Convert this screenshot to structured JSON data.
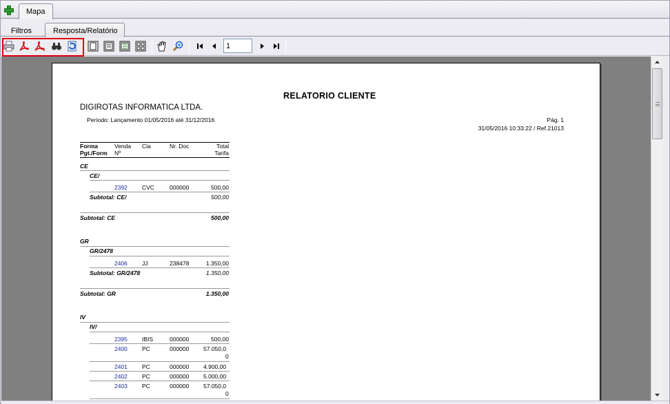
{
  "tabs": {
    "top": [
      {
        "label": "Mapa"
      }
    ],
    "sub": [
      {
        "label": "Filtros"
      },
      {
        "label": "Resposta/Relatório"
      }
    ]
  },
  "toolbar": {
    "icons": [
      "print-icon",
      "pdf-icon",
      "pdf-export-icon",
      "find-icon",
      "refresh-icon",
      "single-page-icon",
      "page-width-icon",
      "multi-page-icon",
      "thumbnails-icon",
      "hand-icon",
      "zoom-icon",
      "first-page-icon",
      "prev-page-icon",
      "next-page-icon",
      "last-page-icon"
    ],
    "page_value": "1"
  },
  "report": {
    "title": "RELATORIO CLIENTE",
    "company": "DIGIROTAS INFORMATICA LTDA.",
    "periodo": "Período: Lançamento 01/05/2016 até 31/12/2016",
    "pagina": "Pág. 1",
    "datetime": "31/05/2016 10:33:22 / Ref.21013",
    "headers": {
      "forma": "Forma",
      "forma2": "Pgt./Form",
      "venda": "Venda",
      "venda2": "Nº",
      "cia": "Cia",
      "nrdoc": "Nr. Doc",
      "total": "Total",
      "total2": "Tarifa"
    },
    "groups": {
      "ce": "CE",
      "ce_sub": "CE/",
      "ce_row": {
        "venda": "2392",
        "cia": "CVC",
        "doc": "000000",
        "val": "500,00"
      },
      "ce_subtotal_label": "Subtotal: CE/",
      "ce_subtotal_val": "500,00",
      "ce_total_label": "Subtotal: CE",
      "ce_total_val": "500,00",
      "gr": "GR",
      "gr_sub": "GR/2478",
      "gr_row": {
        "venda": "2406",
        "cia": "JJ",
        "doc": "238478",
        "val": "1.350,00"
      },
      "gr_subtotal_label": "Subtotal: GR/2478",
      "gr_subtotal_val": "1.350,00",
      "gr_total_label": "Subtotal: GR",
      "gr_total_val": "1.350,00",
      "iv": "IV",
      "iv_sub": "IV/",
      "iv_rows": [
        {
          "venda": "2395",
          "cia": "IBIS",
          "doc": "000000",
          "val": "500,00",
          "val2": ""
        },
        {
          "venda": "2400",
          "cia": "PC",
          "doc": "000000",
          "val": "57.050,0",
          "val2": "0"
        },
        {
          "venda": "2401",
          "cia": "PC",
          "doc": "000000",
          "val": "4.900,00",
          "val2": ""
        },
        {
          "venda": "2402",
          "cia": "PC",
          "doc": "000000",
          "val": "5.000,00",
          "val2": ""
        },
        {
          "venda": "2403",
          "cia": "PC",
          "doc": "000000",
          "val": "57.050,0",
          "val2": "0"
        }
      ]
    }
  }
}
